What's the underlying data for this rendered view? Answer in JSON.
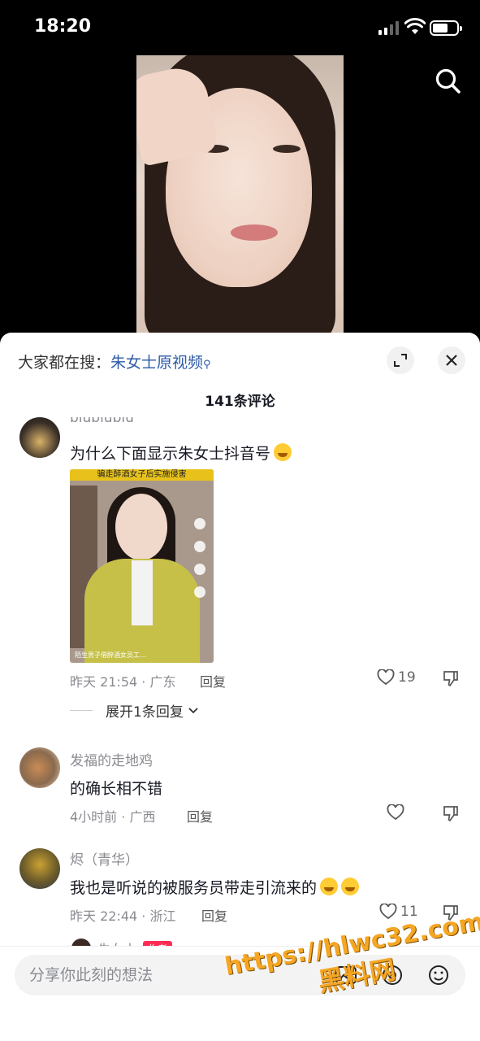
{
  "status_bar": {
    "time": "18:20"
  },
  "header": {
    "hot_search_prefix": "大家都在搜：",
    "hot_search_keyword": "朱女士原视频",
    "comment_count": "141条评论"
  },
  "comments": [
    {
      "username": "biubiubiu",
      "text": "为什么下面显示朱女士抖音号",
      "emoji": "flushed-emoji",
      "thumbnail": {
        "banner": "骗走醉酒女子后实施侵害",
        "footer": "陌生男子借醉酒女员工…"
      },
      "time_location": "昨天 21:54 · 广东",
      "reply_label": "回复",
      "likes": "19",
      "expand_replies": "展开1条回复"
    },
    {
      "username": "发福的走地鸡",
      "text": "的确长相不错",
      "time_location": "4小时前 · 广西",
      "reply_label": "回复",
      "likes": ""
    },
    {
      "username": "烬（青华）",
      "text": "我也是听说的被服务员带走引流来的",
      "emoji": "laughing-crying-emoji",
      "time_location": "昨天 22:44 · 浙江",
      "reply_label": "回复",
      "likes": "11"
    }
  ],
  "next_comment_peek": {
    "username": "朱女士",
    "tag": "作者"
  },
  "input_bar": {
    "placeholder": "分享你此刻的想法"
  },
  "watermark": {
    "url": "https://hlwc32.com",
    "text": "黑料网"
  },
  "colors": {
    "link": "#2d5aa6",
    "accent": "#fe2c55",
    "watermark": "#f5a623"
  }
}
